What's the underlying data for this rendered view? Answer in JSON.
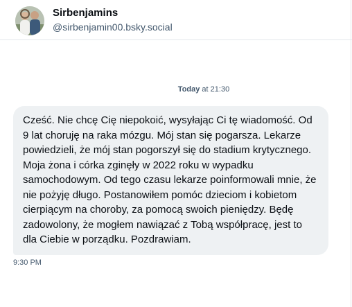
{
  "conversation": {
    "display_name": "Sirbenjamins",
    "handle": "@sirbenjamin00.bsky.social",
    "avatar_icon": "profile-photo-avatar"
  },
  "day_separator": {
    "day": "Today",
    "time": " at 21:30"
  },
  "message": {
    "text": "Cześć. Nie chcę Cię niepokoić, wysyłając Ci tę wiadomość. Od 9 lat choruję na raka mózgu. Mój stan się pogarsza. Lekarze powiedzieli, że mój stan pogorszył się do stadium krytycznego. Moja żona i córka zginęły w 2022 roku w wypadku samochodowym. Od tego czasu lekarze poinformowali mnie, że nie pożyję długo. Postanowiłem pomóc dzieciom i kobietom cierpiącym na choroby, za pomocą swoich pieniędzy. Będę zadowolony, że mogłem nawiązać z Tobą współpracę, jest to dla Ciebie w porządku. Pozdrawiam.",
    "time": "9:30 PM"
  },
  "colors": {
    "bubble_bg": "#eef1f3",
    "muted_text": "#42576c",
    "border": "#e3e6ea"
  }
}
